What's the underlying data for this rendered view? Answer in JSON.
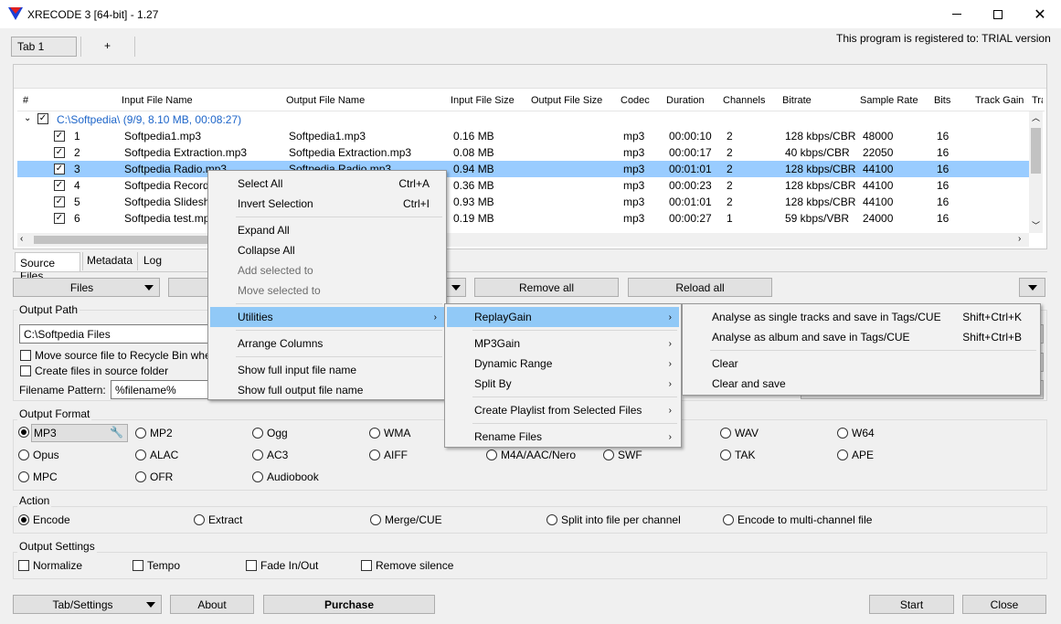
{
  "window": {
    "title": "XRECODE 3 [64-bit] - 1.27",
    "controls": [
      "minimize",
      "maximize",
      "close"
    ]
  },
  "tabs": {
    "tab1": "Tab 1",
    "add": "+"
  },
  "registration": "This program is registered to: TRIAL version",
  "table": {
    "columns": [
      "#",
      "Input File Name",
      "Output File Name",
      "Input File Size",
      "Output File Size",
      "Codec",
      "Duration",
      "Channels",
      "Bitrate",
      "Sample Rate",
      "Bits",
      "Track Gain",
      "Tra"
    ],
    "group": "C:\\Softpedia\\ (9/9, 8.10 MB, 00:08:27)",
    "rows": [
      {
        "n": "1",
        "in": "Softpedia1.mp3",
        "out": "Softpedia1.mp3",
        "size": "0.16 MB",
        "codec": "mp3",
        "dur": "00:00:10",
        "ch": "2",
        "br": "128 kbps/CBR",
        "sr": "48000",
        "bits": "16"
      },
      {
        "n": "2",
        "in": "Softpedia Extraction.mp3",
        "out": "Softpedia Extraction.mp3",
        "size": "0.08 MB",
        "codec": "mp3",
        "dur": "00:00:17",
        "ch": "2",
        "br": "40 kbps/CBR",
        "sr": "22050",
        "bits": "16"
      },
      {
        "n": "3",
        "in": "Softpedia Radio.mp3",
        "out": "Softpedia Radio.mp3",
        "size": "0.94 MB",
        "codec": "mp3",
        "dur": "00:01:01",
        "ch": "2",
        "br": "128 kbps/CBR",
        "sr": "44100",
        "bits": "16"
      },
      {
        "n": "4",
        "in": "Softpedia Record",
        "out": "",
        "size": "0.36 MB",
        "codec": "mp3",
        "dur": "00:00:23",
        "ch": "2",
        "br": "128 kbps/CBR",
        "sr": "44100",
        "bits": "16"
      },
      {
        "n": "5",
        "in": "Softpedia Slidesh",
        "out": "",
        "size": "0.93 MB",
        "codec": "mp3",
        "dur": "00:01:01",
        "ch": "2",
        "br": "128 kbps/CBR",
        "sr": "44100",
        "bits": "16"
      },
      {
        "n": "6",
        "in": "Softpedia test.mp",
        "out": "",
        "size": "0.19 MB",
        "codec": "mp3",
        "dur": "00:00:27",
        "ch": "1",
        "br": "59 kbps/VBR",
        "sr": "24000",
        "bits": "16"
      }
    ]
  },
  "bottom_tabs": [
    "Source Files",
    "Metadata",
    "Log"
  ],
  "toolbar": {
    "files": "Files",
    "remove_all": "Remove all",
    "reload_all": "Reload all"
  },
  "output_path": {
    "label": "Output Path",
    "value": "C:\\Softpedia Files",
    "recycle": "Move source file to Recycle Bin whe",
    "source_folder": "Create files in source folder",
    "pattern_label": "Filename Pattern:",
    "pattern_value": "%filename%"
  },
  "output_format": {
    "label": "Output Format",
    "row1": [
      "MP3",
      "MP2",
      "Ogg",
      "WMA",
      "WAV",
      "W64"
    ],
    "row2": [
      "Opus",
      "ALAC",
      "AC3",
      "AIFF",
      "M4A/AAC/Nero",
      "SWF",
      "TAK",
      "APE"
    ],
    "row3": [
      "MPC",
      "OFR",
      "Audiobook"
    ]
  },
  "action": {
    "label": "Action",
    "options": [
      "Encode",
      "Extract",
      "Merge/CUE",
      "Split into file per channel",
      "Encode to multi-channel file"
    ]
  },
  "output_settings": {
    "label": "Output Settings",
    "options": [
      "Normalize",
      "Tempo",
      "Fade In/Out",
      "Remove silence"
    ]
  },
  "footer": {
    "tab_settings": "Tab/Settings",
    "about": "About",
    "purchase": "Purchase",
    "start": "Start",
    "close": "Close"
  },
  "context_menu": {
    "select_all": "Select All",
    "select_all_sc": "Ctrl+A",
    "invert": "Invert Selection",
    "invert_sc": "Ctrl+I",
    "expand": "Expand All",
    "collapse": "Collapse All",
    "add_to": "Add selected to",
    "move_to": "Move selected to",
    "utilities": "Utilities",
    "arrange": "Arrange Columns",
    "full_in": "Show full input file name",
    "full_out": "Show full output file name"
  },
  "utilities_menu": {
    "replaygain": "ReplayGain",
    "mp3gain": "MP3Gain",
    "dynamic": "Dynamic Range",
    "split": "Split By",
    "playlist": "Create Playlist from Selected Files",
    "rename": "Rename Files"
  },
  "replaygain_menu": {
    "single": "Analyse as single tracks and save in Tags/CUE",
    "single_sc": "Shift+Ctrl+K",
    "album": "Analyse as album and save in Tags/CUE",
    "album_sc": "Shift+Ctrl+B",
    "clear": "Clear",
    "clear_save": "Clear and save"
  }
}
